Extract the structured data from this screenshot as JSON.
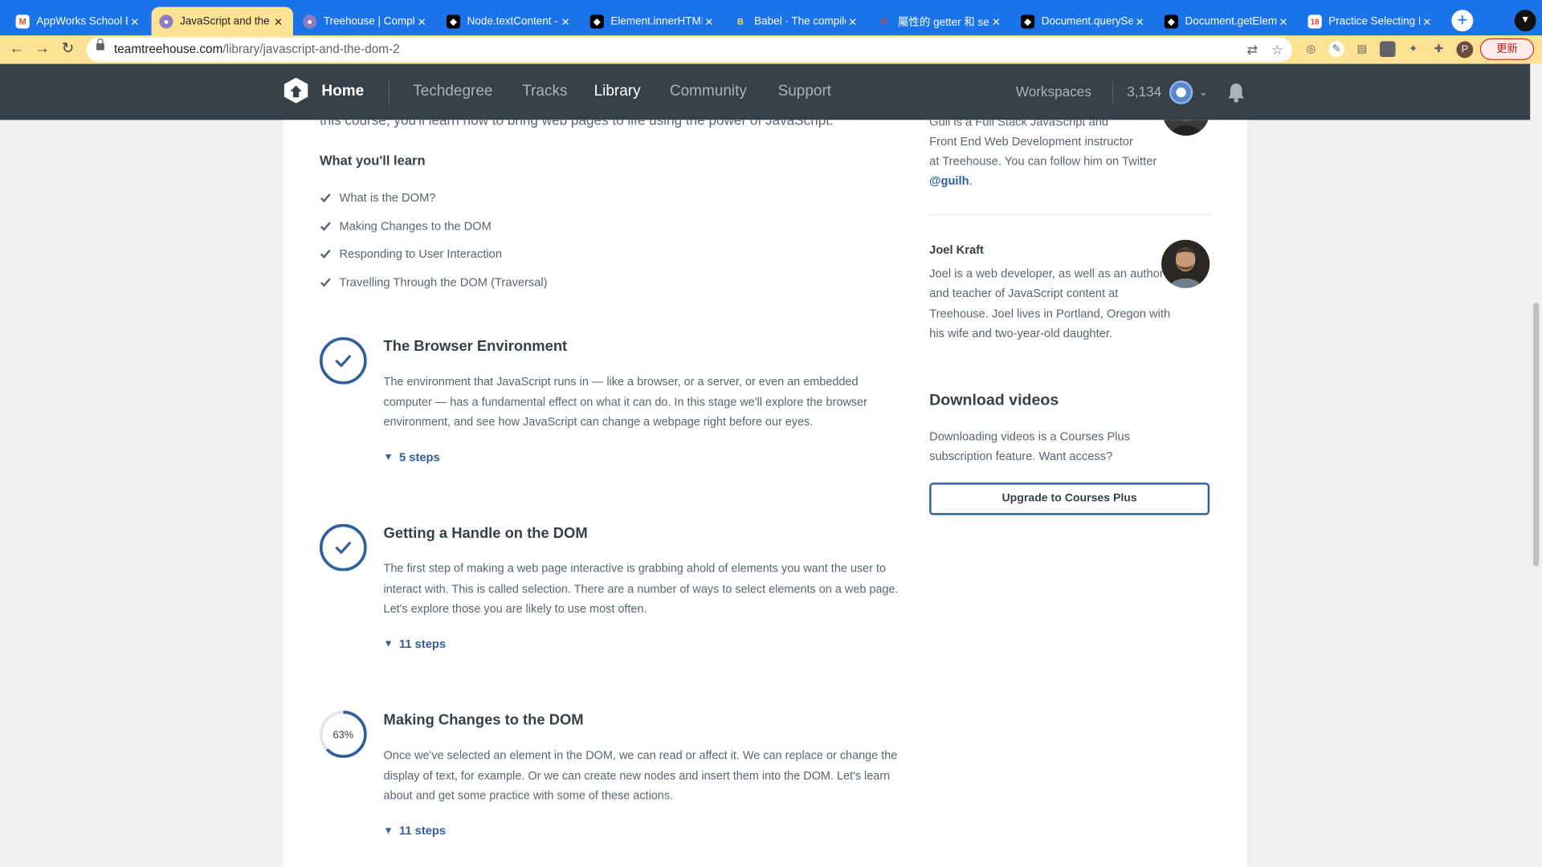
{
  "browser": {
    "tabs": [
      {
        "title": "AppWorks School B",
        "icon": "gmail-icon",
        "active": false
      },
      {
        "title": "JavaScript and the D",
        "icon": "treehouse-icon",
        "active": true
      },
      {
        "title": "Treehouse | Comple",
        "icon": "treehouse-icon",
        "active": false
      },
      {
        "title": "Node.textContent -",
        "icon": "mdn-icon",
        "active": false
      },
      {
        "title": "Element.innerHTML",
        "icon": "mdn-icon",
        "active": false
      },
      {
        "title": "Babel · The compiler",
        "icon": "babel-icon",
        "active": false
      },
      {
        "title": "屬性的 getter 和 sett",
        "icon": "site-icon",
        "active": false
      },
      {
        "title": "Document.querySel",
        "icon": "mdn-icon",
        "active": false
      },
      {
        "title": "Document.getEleme",
        "icon": "mdn-icon",
        "active": false
      },
      {
        "title": "Practice Selecting D",
        "icon": "calendar-icon",
        "active": false
      }
    ],
    "url_host": "teamtreehouse.com",
    "url_path": "/library/javascript-and-the-dom-2",
    "profile_initial": "P",
    "update_label": "更新"
  },
  "nav": {
    "home": "Home",
    "links": [
      "Techdegree",
      "Tracks",
      "Library",
      "Community",
      "Support"
    ],
    "active_link": "Library",
    "workspaces": "Workspaces",
    "points": "3,134"
  },
  "course": {
    "intro_cut": "this course, you'll learn how to bring web pages to life using the power of JavaScript.",
    "what_youll_learn": "What you'll learn",
    "learn_items": [
      "What is the DOM?",
      "Making Changes to the DOM",
      "Responding to User Interaction",
      "Travelling Through the DOM (Traversal)"
    ],
    "stages": [
      {
        "title": "The Browser Environment",
        "status": "complete",
        "progress": 1.0,
        "description": "The environment that JavaScript runs in — like a browser, or a server, or even an embedded computer — has a fundamental effect on what it can do. In this stage we'll explore the browser environment, and see how JavaScript can change a webpage right before our eyes.",
        "steps": "5 steps"
      },
      {
        "title": "Getting a Handle on the DOM",
        "status": "complete",
        "progress": 1.0,
        "description": "The first step of making a web page interactive is grabbing ahold of elements you want the user to interact with. This is called selection. There are a number of ways to select elements on a web page. Let's explore those you are likely to use most often.",
        "steps": "11 steps"
      },
      {
        "title": "Making Changes to the DOM",
        "status": "in-progress",
        "progress": 0.63,
        "progress_label": "63%",
        "description": "Once we've selected an element in the DOM, we can read or affect it. We can replace or change the display of text, for example. Or we can create new nodes and insert them into the DOM. Let's learn about and get some practice with some of these actions.",
        "steps": "11 steps"
      }
    ]
  },
  "sidebar": {
    "instructor1_bio_lines": [
      "Guil is a Full Stack JavaScript and",
      "Front End Web Development instructor",
      "at Treehouse. You can follow him on Twitter"
    ],
    "instructor1_handle": "@guilh",
    "instructor2_name": "Joel Kraft",
    "instructor2_bio": "Joel is a web developer, as well as an author and teacher of JavaScript content at Treehouse. Joel lives in Portland, Oregon with his wife and two-year-old daughter.",
    "download_title": "Download videos",
    "download_desc": "Downloading videos is a Courses Plus subscription feature. Want access?",
    "upgrade_label": "Upgrade to Courses Plus"
  },
  "colors": {
    "chrome_tabstrip": "#1a73e8",
    "active_tab": "#fde293",
    "site_nav": "#384047",
    "stage_ring": "#2f5f9f",
    "link": "#2f5f9f"
  }
}
